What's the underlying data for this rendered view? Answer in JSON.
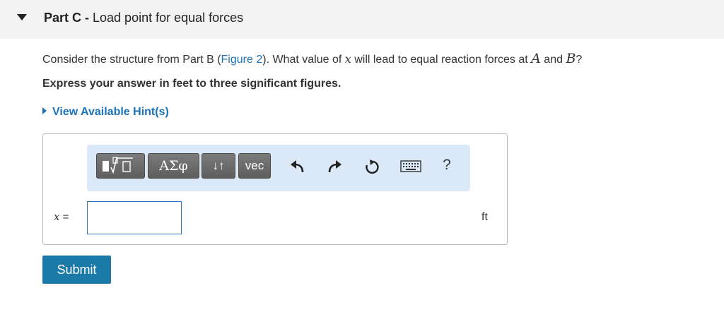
{
  "part": {
    "label": "Part C",
    "separator": " - ",
    "title": "Load point for equal forces"
  },
  "question": {
    "prefix": "Consider the structure from Part B (",
    "figure_link": "Figure 2",
    "middle": "). What value of ",
    "variable": "x",
    "middle2": " will lead to equal reaction forces at ",
    "point_a": "A",
    "and": " and ",
    "point_b": "B",
    "suffix": "?"
  },
  "instruction": "Express your answer in feet to three significant figures.",
  "hints_label": "View Available Hint(s)",
  "toolbar": {
    "templates_icon": "templates-icon",
    "greek_label": "ΑΣφ",
    "arrows_label": "↓↑",
    "vec_label": "vec",
    "undo_icon": "undo-icon",
    "redo_icon": "redo-icon",
    "reset_icon": "reset-icon",
    "keyboard_icon": "keyboard-icon",
    "help_label": "?"
  },
  "answer": {
    "variable": "x",
    "equals": " =",
    "value": "",
    "unit": "ft"
  },
  "submit_label": "Submit",
  "colors": {
    "link": "#1a72b8",
    "submit": "#1c7aa9",
    "toolbar_bg": "#dbe8f7",
    "input_border": "#2f77b9"
  }
}
